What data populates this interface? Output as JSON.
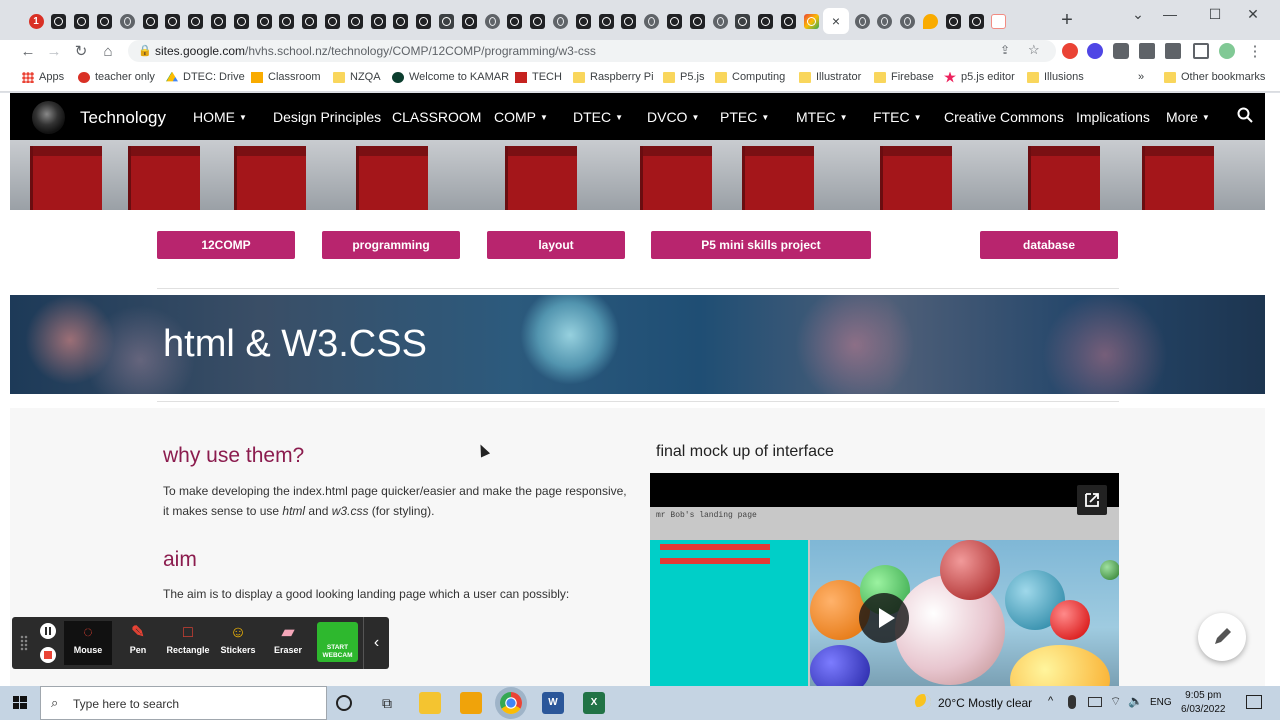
{
  "browser": {
    "tab_count_badge": "1",
    "active_tab_close": "×",
    "new_tab": "+",
    "url_host": "sites.google.com",
    "url_path": "/hvhs.school.nz/technology/COMP/12COMP/programming/w3-css"
  },
  "bookmarks": [
    {
      "label": "Apps"
    },
    {
      "label": "teacher only"
    },
    {
      "label": "DTEC: Drive"
    },
    {
      "label": "Classroom"
    },
    {
      "label": "NZQA"
    },
    {
      "label": "Welcome to KAMAR"
    },
    {
      "label": "TECH"
    },
    {
      "label": "Raspberry Pi"
    },
    {
      "label": "P5.js"
    },
    {
      "label": "Computing"
    },
    {
      "label": "Illustrator"
    },
    {
      "label": "Firebase"
    },
    {
      "label": "p5.js editor"
    },
    {
      "label": "Illusions"
    },
    {
      "label": "Other bookmarks"
    }
  ],
  "bookmarks_overflow": "»",
  "site": {
    "name": "Technology",
    "nav": [
      {
        "label": "HOME",
        "dropdown": true
      },
      {
        "label": "Design Principles",
        "dropdown": false
      },
      {
        "label": "CLASSROOM",
        "dropdown": false
      },
      {
        "label": "COMP",
        "dropdown": true
      },
      {
        "label": "DTEC",
        "dropdown": true
      },
      {
        "label": "DVCO",
        "dropdown": true
      },
      {
        "label": "PTEC",
        "dropdown": true
      },
      {
        "label": "MTEC",
        "dropdown": true
      },
      {
        "label": "FTEC",
        "dropdown": true
      },
      {
        "label": "Creative Commons",
        "dropdown": false
      },
      {
        "label": "Implications",
        "dropdown": false
      },
      {
        "label": "More",
        "dropdown": true
      }
    ],
    "buttons": [
      "12COMP",
      "programming",
      "layout",
      "P5 mini skills project",
      "database"
    ],
    "hero_title": "html & W3.CSS",
    "why_heading": "why use  them?",
    "why_text_1": "To make developing the index.html page quicker/easier and make the page responsive,",
    "why_text_2a": "it makes sense to use ",
    "why_text_2b": "html",
    "why_text_2c": " and ",
    "why_text_2d": "w3.css",
    "why_text_2e": " (for styling).",
    "aim_heading": "aim",
    "aim_text": "The aim is to display a good looking landing page which a user can possibly:",
    "mock_title": "final mock up of interface",
    "video_header": "mr Bob's landing page"
  },
  "recorder": {
    "tools": [
      "Mouse",
      "Pen",
      "Rectangle",
      "Stickers",
      "Eraser"
    ],
    "webcam_line1": "START",
    "webcam_line2": "WEBCAM"
  },
  "taskbar": {
    "search_placeholder": "Type here to search",
    "weather": "20°C  Mostly clear",
    "lang": "ENG",
    "time": "9:05 pm",
    "date": "6/03/2022"
  },
  "colors": {
    "accent": "#b8256e",
    "heading": "#8b1c4e",
    "nav_bg": "#000000"
  }
}
